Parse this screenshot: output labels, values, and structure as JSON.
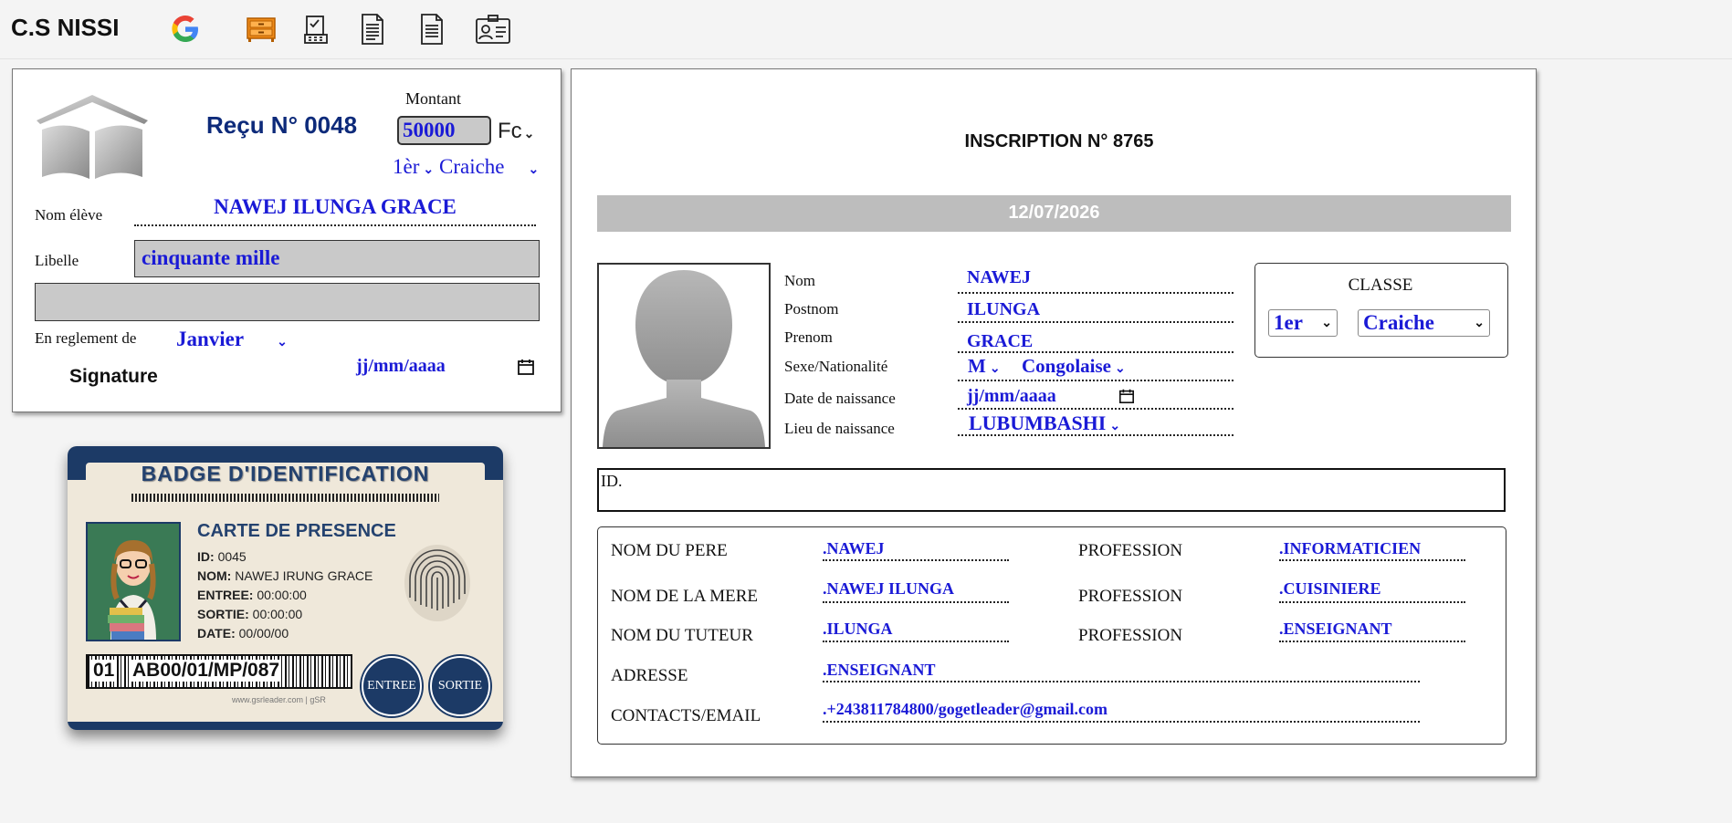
{
  "topbar": {
    "brand": "C.S NISSI",
    "icons": [
      "google-icon",
      "drawer-icon",
      "checklist-icon",
      "document-icon",
      "file-icon",
      "contact-card-icon"
    ]
  },
  "receipt": {
    "montant_label": "Montant",
    "receipt_title": "Reçu N° 0048",
    "amount_value": "50000",
    "currency": "Fc",
    "classe_level": "1èr",
    "classe_option": "Craiche",
    "nom_label": "Nom élève",
    "student_name": "NAWEJ ILUNGA GRACE",
    "libelle_label": "Libelle",
    "libelle_value": "cinquante mille",
    "reglement_label": "En reglement de",
    "month": "Janvier",
    "signature_label": "Signature",
    "date_placeholder": "jj/mm/aaaa"
  },
  "badge": {
    "title": "BADGE D'IDENTIFICATION",
    "subtitle": "CARTE DE PRESENCE",
    "rows": [
      {
        "k": "ID:",
        "v": "0045"
      },
      {
        "k": "NOM:",
        "v": "NAWEJ IRUNG GRACE"
      },
      {
        "k": "ENTREE:",
        "v": "00:00:00"
      },
      {
        "k": "SORTIE:",
        "v": "00:00:00"
      },
      {
        "k": "DATE:",
        "v": "00/00/00"
      }
    ],
    "barcode_prefix": "01",
    "barcode_code": "AB00/01/MP/087",
    "entree_button": "ENTREE",
    "sortie_button": "SORTIE",
    "footer": "www.gsrleader.com | gSR"
  },
  "inscription": {
    "title": "INSCRIPTION N° 8765",
    "date": "12/07/2026",
    "fields": [
      {
        "label": "Nom",
        "value": "NAWEJ"
      },
      {
        "label": "Postnom",
        "value": "ILUNGA"
      },
      {
        "label": "Prenom",
        "value": "GRACE"
      },
      {
        "label": "Sexe/Nationalité",
        "sexe": "M",
        "nationalite": "Congolaise"
      },
      {
        "label": "Date de naissance",
        "value": "jj/mm/aaaa"
      },
      {
        "label": "Lieu de naissance",
        "value": "LUBUMBASHI"
      }
    ],
    "classe_title": "CLASSE",
    "classe_level": "1er",
    "classe_option": "Craiche",
    "id_label": "ID.",
    "parents": {
      "pere_label": "NOM DU PERE",
      "pere": ".NAWEJ",
      "mere_label": "NOM DE LA MERE",
      "mere": ".NAWEJ ILUNGA",
      "tuteur_label": "NOM DU TUTEUR",
      "tuteur": ".ILUNGA",
      "profession_label": "PROFESSION",
      "prof_pere": ".INFORMATICIEN",
      "prof_mere": ".CUISINIERE",
      "prof_tuteur": ".ENSEIGNANT",
      "adresse_label": "ADRESSE",
      "adresse": ".ENSEIGNANT",
      "contacts_label": "CONTACTS/EMAIL",
      "contacts": ".+243811784800/gogetleader@gmail.com"
    }
  },
  "colors": {
    "accent_blue": "#1a1ad6",
    "navy": "#0d2a7a",
    "badge_navy": "#1c3a66",
    "date_bar": "#bdbdbd"
  }
}
